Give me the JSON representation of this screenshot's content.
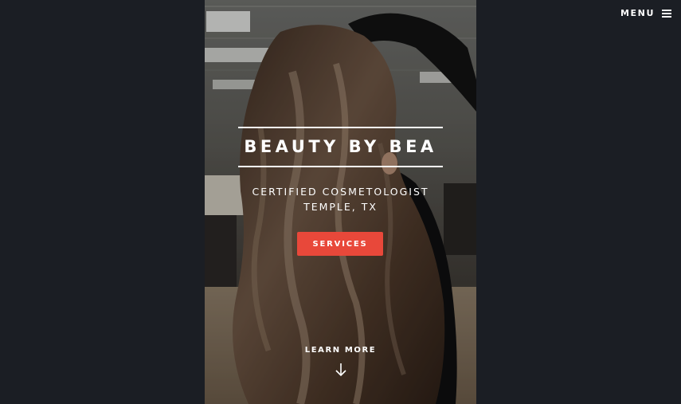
{
  "nav": {
    "menu_label": "MENU",
    "menu_icon": "hamburger-icon"
  },
  "hero": {
    "title": "BEAUTY BY BEA",
    "tagline_line1": "CERTIFIED COSMETOLOGIST",
    "tagline_line2": "TEMPLE, TX",
    "cta_label": "SERVICES",
    "learn_more_label": "LEARN MORE",
    "learn_more_icon": "arrow-down-icon",
    "background_image": "woman-with-long-wavy-balayage-hair-in-salon"
  },
  "colors": {
    "page_background": "#1b1e24",
    "accent": "#e8483a",
    "text": "#ffffff"
  }
}
